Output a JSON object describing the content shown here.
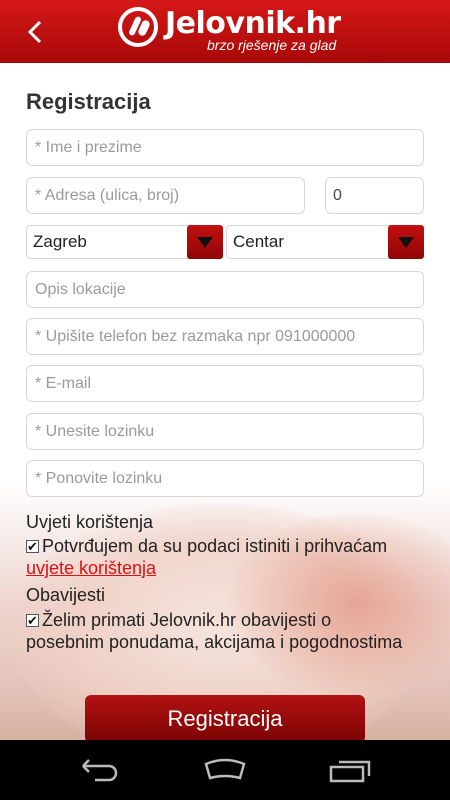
{
  "header": {
    "logo_text": "Jelovnik.hr",
    "tagline": "brzo rješenje za glad",
    "brand_color": "#c41010"
  },
  "form": {
    "title": "Registracija",
    "name_placeholder": "* Ime i prezime",
    "address_placeholder": "* Adresa (ulica, broj)",
    "house_number_value": "0",
    "city_selected": "Zagreb",
    "district_selected": "Centar",
    "location_desc_placeholder": "Opis lokacije",
    "phone_placeholder": "* Upišite telefon bez razmaka npr 091000000",
    "email_placeholder": "* E-mail",
    "password_placeholder": "* Unesite lozinku",
    "password_repeat_placeholder": "* Ponovite lozinku",
    "terms_label": "Uvjeti korištenja",
    "terms_check_text": "Potvrđujem da su podaci istiniti i prihvaćam",
    "terms_link": "uvjete korištenja",
    "terms_checked": true,
    "notifications_label": "Obavijesti",
    "notifications_check_text": "Želim primati Jelovnik.hr obavijesti o posebnim ponudama, akcijama i pogodnostima",
    "notifications_checked": true,
    "submit_label": "Registracija"
  },
  "navbar": {
    "icons": [
      "back-icon",
      "home-icon",
      "recent-apps-icon"
    ]
  }
}
